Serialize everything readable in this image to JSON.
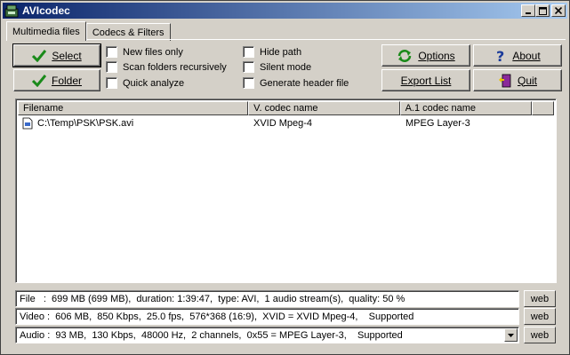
{
  "window": {
    "title": "AVIcodec",
    "minimize": "_",
    "maximize": "□",
    "close": "×"
  },
  "tabs": [
    {
      "label": "Multimedia files",
      "active": true
    },
    {
      "label": "Codecs & Filters",
      "active": false
    }
  ],
  "buttons": {
    "select": "Select",
    "folder": "Folder",
    "options": "Options",
    "about": "About",
    "export": "Export List",
    "quit": "Quit"
  },
  "checkboxes": [
    {
      "label": "New files only",
      "checked": false
    },
    {
      "label": "Scan folders recursively",
      "checked": false
    },
    {
      "label": "Quick analyze",
      "checked": false
    },
    {
      "label": "Hide path",
      "checked": false
    },
    {
      "label": "Silent mode",
      "checked": false
    },
    {
      "label": "Generate header file",
      "checked": false
    }
  ],
  "list": {
    "columns": [
      "Filename",
      "V. codec name",
      "A.1 codec name"
    ],
    "rows": [
      {
        "filename": "C:\\Temp\\PSK\\PSK.avi",
        "vcodec": "XVID Mpeg-4",
        "acodec": "MPEG Layer-3"
      }
    ]
  },
  "info": {
    "file": "File   :  699 MB (699 MB),  duration: 1:39:47,  type: AVI,  1 audio stream(s),  quality: 50 %",
    "video": "Video :  606 MB,  850 Kbps,  25.0 fps,  576*368 (16:9),  XVID = XVID Mpeg-4,    Supported",
    "audio": "Audio :  93 MB,  130 Kbps,  48000 Hz,  2 channels,  0x55 = MPEG Layer-3,    Supported",
    "web_label": "web"
  },
  "colors": {
    "titlebar_start": "#0a246a",
    "titlebar_end": "#a6caf0",
    "face": "#d4d0c8"
  }
}
